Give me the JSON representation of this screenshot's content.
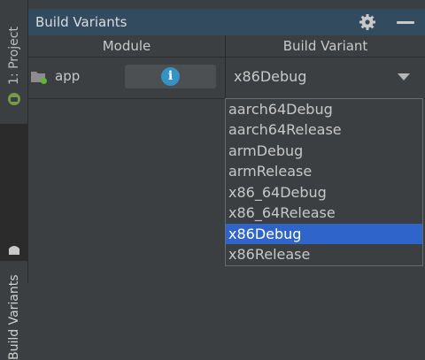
{
  "strip": {
    "project_label": "1: Project",
    "variants_label": "Build Variants",
    "project_icon": "android-icon",
    "variants_icon": "android-icon"
  },
  "panel": {
    "title": "Build Variants",
    "settings_icon": "gear-icon",
    "minimize_icon": "minimize-icon"
  },
  "table": {
    "headers": {
      "module": "Module",
      "variant": "Build Variant"
    },
    "row": {
      "module": "app",
      "info_icon": "i",
      "variant": "x86Debug"
    }
  },
  "dropdown": {
    "options": [
      "aarch64Debug",
      "aarch64Release",
      "armDebug",
      "armRelease",
      "x86_64Debug",
      "x86_64Release",
      "x86Debug",
      "x86Release"
    ],
    "selected": "x86Debug"
  },
  "colors": {
    "header_bg": "#334b5f",
    "selection": "#2f65ca",
    "info_icon": "#3592c4",
    "module_dot": "#5fb832"
  }
}
